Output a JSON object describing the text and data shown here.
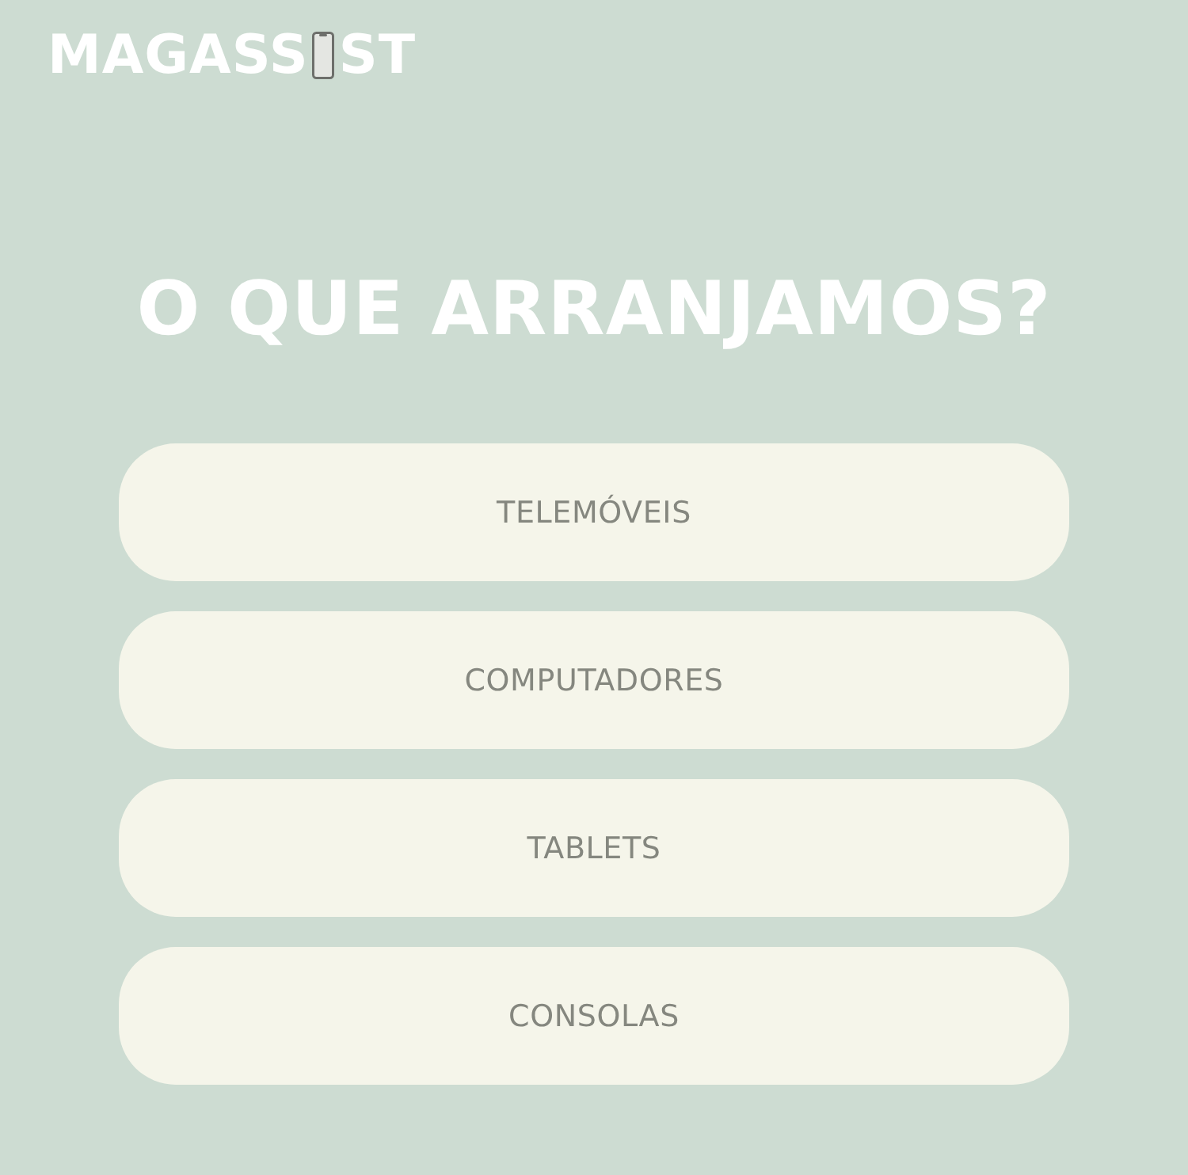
{
  "logo": {
    "text_before": "MAGASS",
    "text_after": "ST"
  },
  "heading": "O QUE ARRANJAMOS?",
  "options": [
    {
      "label": "TELEMÓVEIS"
    },
    {
      "label": "COMPUTADORES"
    },
    {
      "label": "TABLETS"
    },
    {
      "label": "CONSOLAS"
    }
  ]
}
